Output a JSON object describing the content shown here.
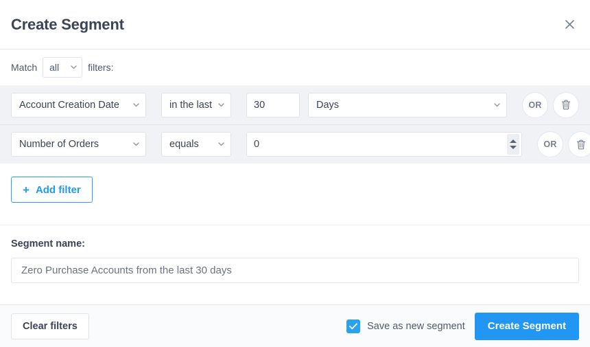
{
  "header": {
    "title": "Create Segment",
    "close_icon": "close-icon"
  },
  "match": {
    "prefix_label": "Match",
    "selected": "all",
    "suffix_label": "filters:"
  },
  "filters": {
    "rows": [
      {
        "field": "Account Creation Date",
        "operator": "in the last",
        "value": "30",
        "unit": "Days",
        "or_label": "OR",
        "delete_icon": "trash-icon",
        "has_spinner": false
      },
      {
        "field": "Number of Orders",
        "operator": "equals",
        "value": "0",
        "unit": "",
        "or_label": "OR",
        "delete_icon": "trash-icon",
        "has_spinner": true
      }
    ],
    "add_filter_label": "Add filter",
    "add_filter_icon": "plus-icon"
  },
  "segment_name": {
    "label": "Segment name:",
    "value": "",
    "placeholder": "Zero Purchase Accounts from the last 30 days"
  },
  "footer": {
    "clear_label": "Clear filters",
    "save_checkbox_label": "Save as new segment",
    "save_checkbox_checked": "true",
    "check_icon": "check-icon",
    "primary_label": "Create Segment"
  },
  "colors": {
    "accent": "#2196f3",
    "accent_border": "#27a0f5",
    "text_dark": "#3c4257",
    "text_muted": "#6b7280",
    "filter_row_bg": "#f0f2f5",
    "footer_bg": "#fafbfc"
  }
}
